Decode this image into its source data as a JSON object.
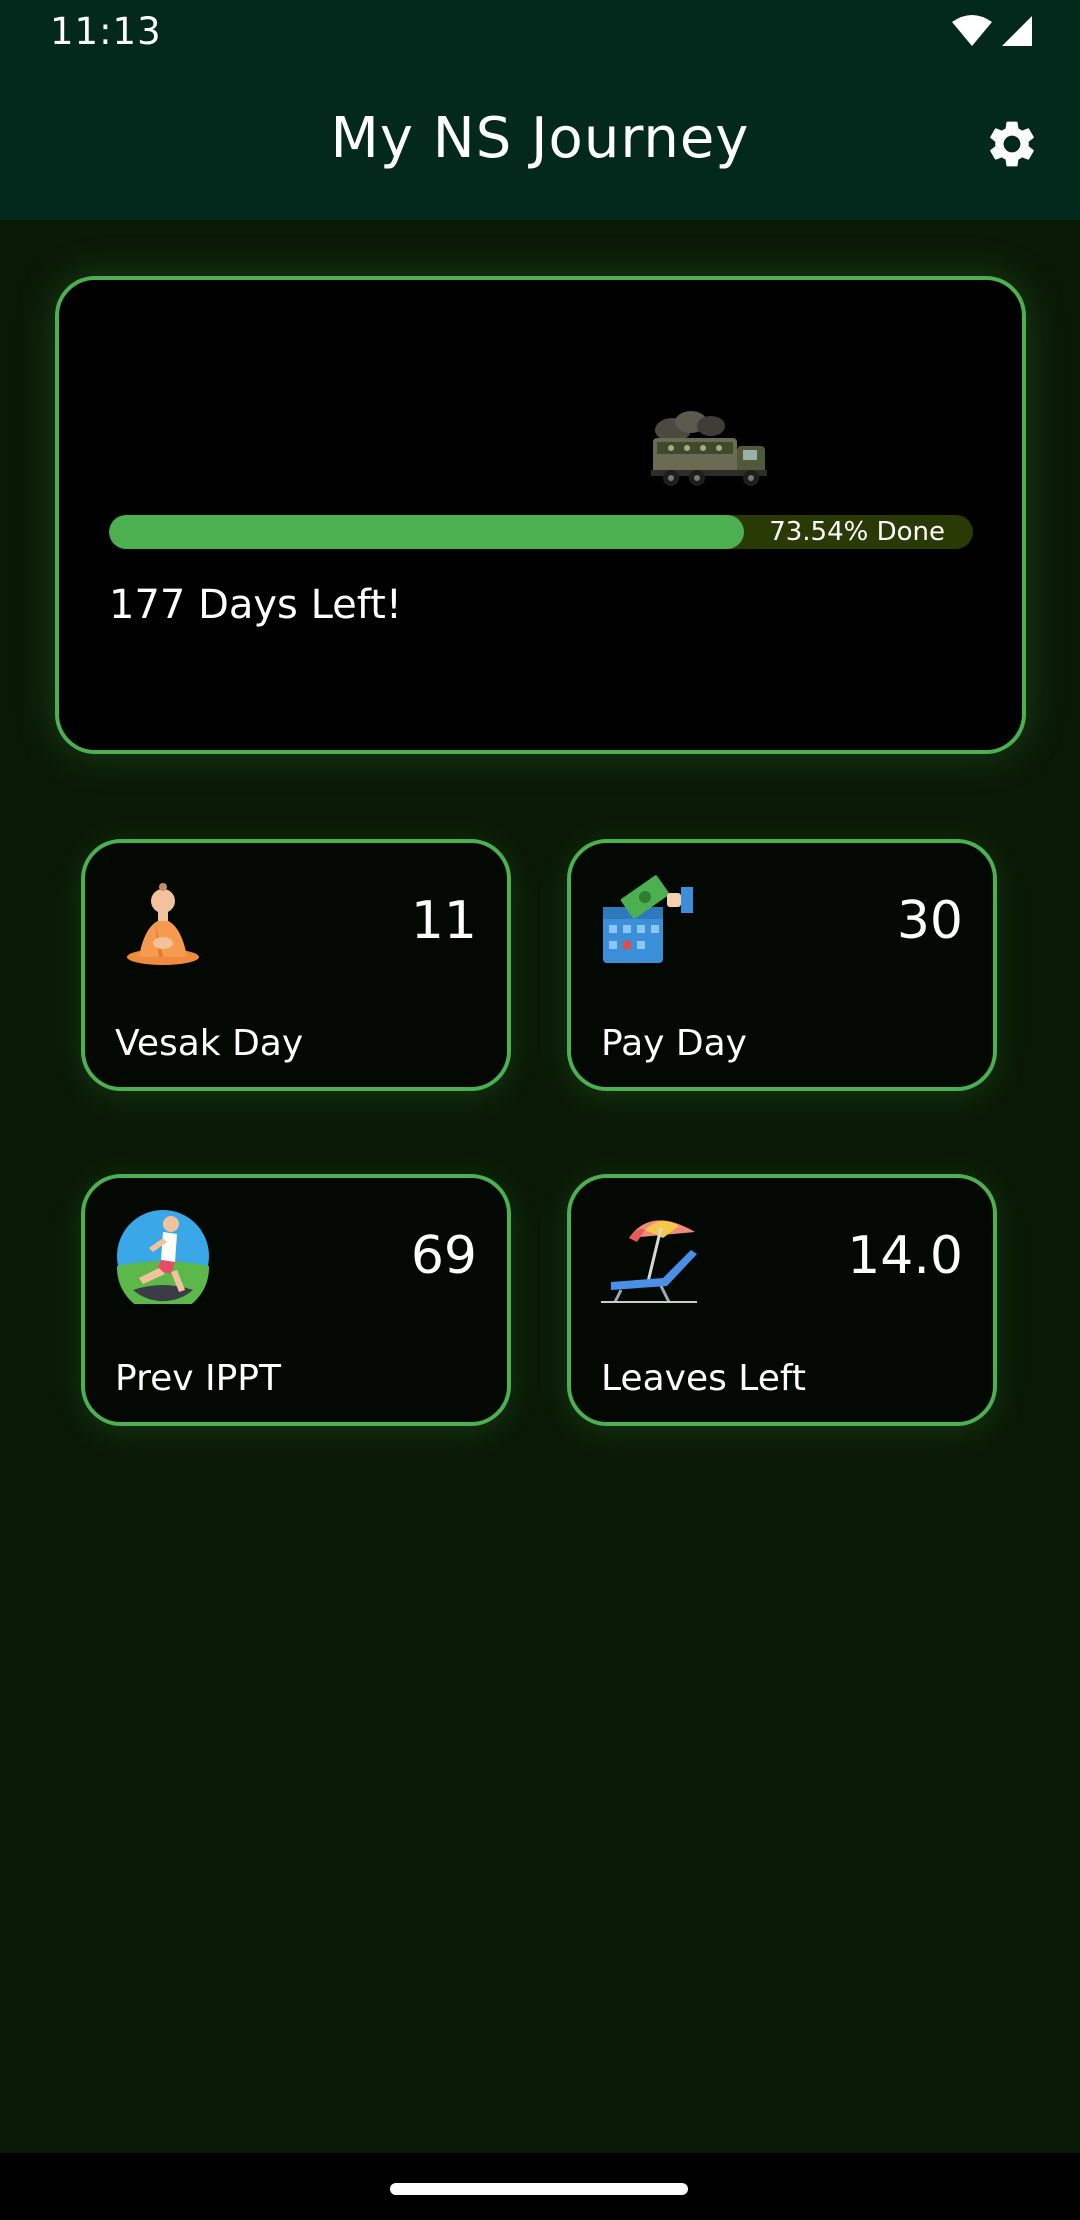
{
  "status_bar": {
    "time": "11:13",
    "icons": [
      "wifi-icon",
      "cellular-signal-icon"
    ]
  },
  "app_bar": {
    "title": "My NS Journey",
    "settings_icon": "gear-icon"
  },
  "progress": {
    "fraction": 0.7354,
    "label": "73.54% Done",
    "days_left": "177 Days Left!",
    "icon": "military-truck-icon"
  },
  "cards": {
    "vesak": {
      "value": "11",
      "label": "Vesak Day",
      "icon": "meditating-monk-icon"
    },
    "pay": {
      "value": "30",
      "label": "Pay Day",
      "icon": "calendar-money-icon"
    },
    "ippt": {
      "value": "69",
      "label": "Prev IPPT",
      "icon": "runner-icon"
    },
    "leave": {
      "value": "14.0",
      "label": "Leaves Left",
      "icon": "beach-chair-umbrella-icon"
    }
  },
  "colors": {
    "accent": "#4caf50",
    "header_bg": "#02291b",
    "page_bg": "#0a1906",
    "track_bg": "#2a3a05"
  }
}
